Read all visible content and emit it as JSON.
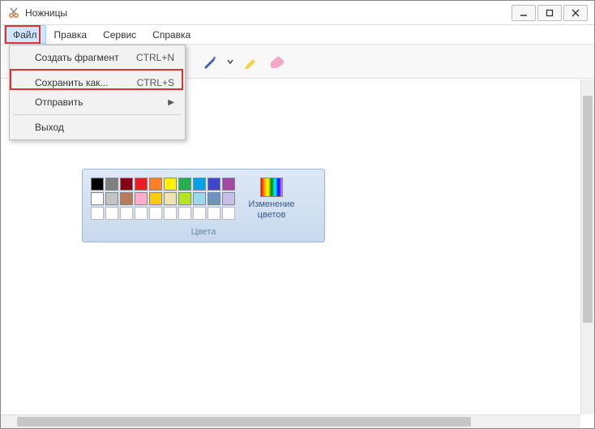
{
  "window": {
    "title": "Ножницы"
  },
  "menubar": {
    "file": "Файл",
    "edit": "Правка",
    "tools": "Сервис",
    "help": "Справка"
  },
  "file_menu": {
    "new": {
      "label": "Создать фрагмент",
      "shortcut": "CTRL+N"
    },
    "save_as": {
      "label": "Сохранить как...",
      "shortcut": "CTRL+S"
    },
    "send": {
      "label": "Отправить"
    },
    "exit": {
      "label": "Выход"
    }
  },
  "palette": {
    "title": "Цвета",
    "edit_colors": "Изменение цветов",
    "row1": [
      "#000000",
      "#7f7f7f",
      "#880015",
      "#ed1c24",
      "#ff7f27",
      "#fff200",
      "#22b14c",
      "#00a2e8",
      "#3f48cc",
      "#a349a4"
    ],
    "row2": [
      "#ffffff",
      "#c3c3c3",
      "#b97a57",
      "#ffaec9",
      "#ffc90e",
      "#efe4b0",
      "#b5e61d",
      "#99d9ea",
      "#7092be",
      "#c8bfe7"
    ]
  }
}
